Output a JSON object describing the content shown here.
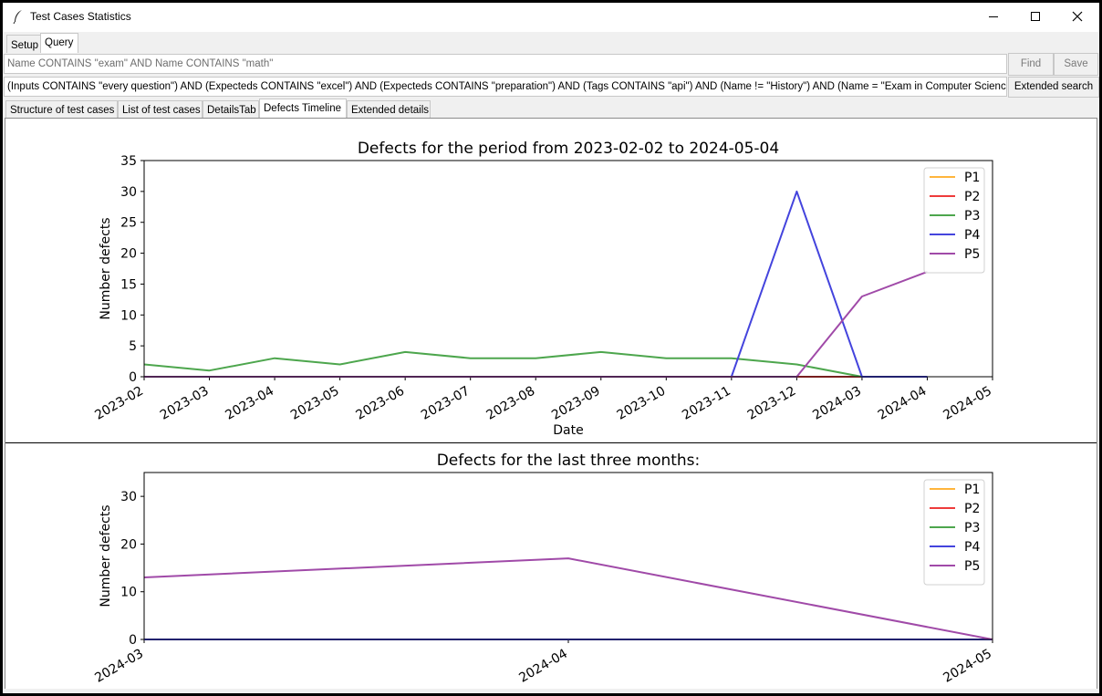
{
  "window": {
    "title": "Test Cases Statistics"
  },
  "top_tabs": [
    {
      "label": "Setup"
    },
    {
      "label": "Query"
    }
  ],
  "search": {
    "value": "",
    "placeholder": "Name CONTAINS \"exam\" AND Name CONTAINS \"math\"",
    "find_label": "Find",
    "save_label": "Save"
  },
  "extended_query": {
    "value": "(Inputs CONTAINS \"every question\") AND (Expecteds CONTAINS \"excel\") AND (Expecteds CONTAINS \"preparation\") AND (Tags CONTAINS \"api\") AND (Name != \"History\") AND (Name = \"Exam in Computer Science\")",
    "button_label": "Extended search"
  },
  "sub_tabs": [
    {
      "label": "Structure of test cases"
    },
    {
      "label": "List of test cases"
    },
    {
      "label": "DetailsTab"
    },
    {
      "label": "Defects Timeline"
    },
    {
      "label": "Extended details"
    }
  ],
  "chart_data": [
    {
      "type": "line",
      "title": "Defects for the period from 2023-02-02 to 2024-05-04",
      "xlabel": "Date",
      "ylabel": "Number defects",
      "categories": [
        "2023-02",
        "2023-03",
        "2023-04",
        "2023-05",
        "2023-06",
        "2023-07",
        "2023-08",
        "2023-09",
        "2023-10",
        "2023-11",
        "2023-12",
        "2024-03",
        "2024-04",
        "2024-05"
      ],
      "ylim": [
        0,
        35
      ],
      "yticks": [
        0,
        5,
        10,
        15,
        20,
        25,
        30,
        35
      ],
      "legend_position": "top-right",
      "grid": false,
      "series": [
        {
          "name": "P1",
          "color": "#ffb53c",
          "values": [
            0,
            0,
            0,
            0,
            0,
            0,
            0,
            0,
            0,
            0,
            0,
            0,
            0,
            null
          ]
        },
        {
          "name": "P2",
          "color": "#ee3b3b",
          "values": [
            0,
            0,
            0,
            0,
            0,
            0,
            0,
            0,
            0,
            0,
            0,
            0,
            0,
            null
          ]
        },
        {
          "name": "P3",
          "color": "#4da64d",
          "values": [
            2,
            1,
            3,
            2,
            4,
            3,
            3,
            4,
            3,
            3,
            2,
            0,
            0,
            null
          ]
        },
        {
          "name": "P4",
          "color": "#4444dd",
          "values": [
            0,
            0,
            0,
            0,
            0,
            0,
            0,
            0,
            0,
            0,
            30,
            0,
            0,
            null
          ]
        },
        {
          "name": "P5",
          "color": "#a04aa8",
          "values": [
            0,
            0,
            0,
            0,
            0,
            0,
            0,
            0,
            0,
            0,
            0,
            13,
            17,
            null
          ]
        }
      ]
    },
    {
      "type": "line",
      "title": "Defects for the last three months:",
      "xlabel": "",
      "ylabel": "Number defects",
      "categories": [
        "2024-03",
        "2024-04",
        "2024-05"
      ],
      "ylim": [
        0,
        35
      ],
      "yticks": [
        0,
        10,
        20,
        30
      ],
      "legend_position": "top-right",
      "grid": false,
      "series": [
        {
          "name": "P1",
          "color": "#ffb53c",
          "values": [
            0,
            0,
            0
          ]
        },
        {
          "name": "P2",
          "color": "#ee3b3b",
          "values": [
            0,
            0,
            0
          ]
        },
        {
          "name": "P3",
          "color": "#4da64d",
          "values": [
            0,
            0,
            0
          ]
        },
        {
          "name": "P4",
          "color": "#4444dd",
          "values": [
            0,
            0,
            0
          ]
        },
        {
          "name": "P5",
          "color": "#a04aa8",
          "values": [
            13,
            17,
            0
          ]
        }
      ]
    }
  ]
}
